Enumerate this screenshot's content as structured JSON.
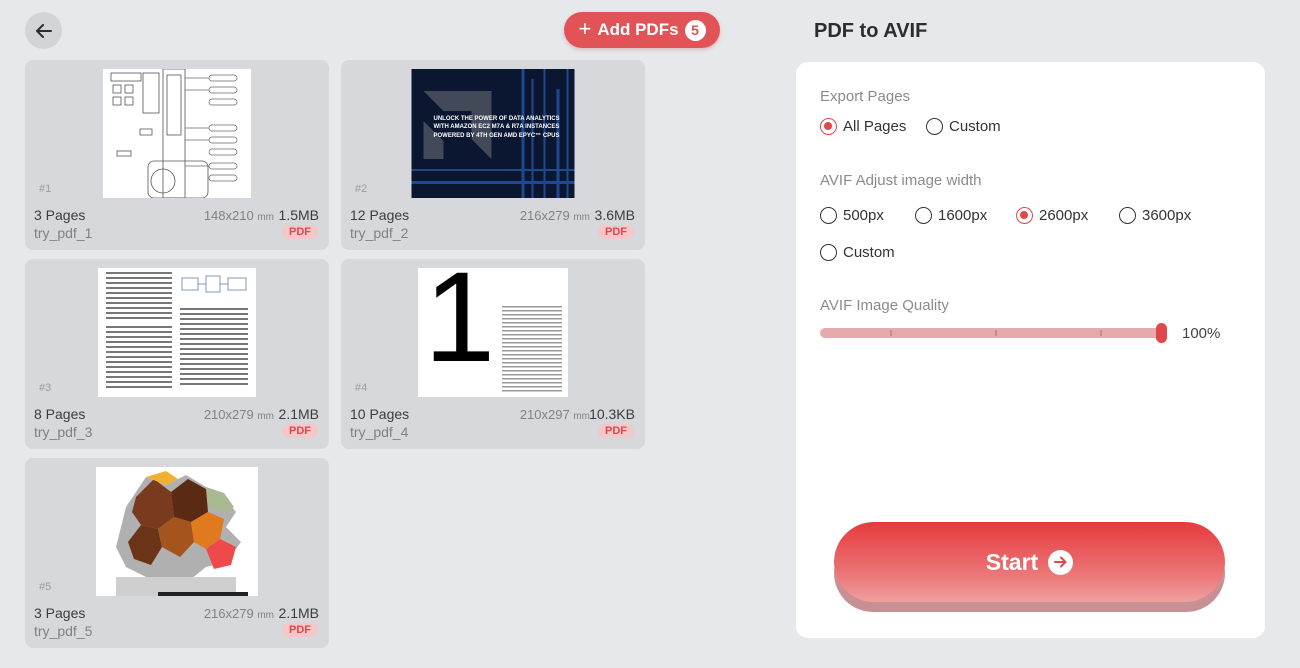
{
  "header": {
    "add_label": "Add PDFs",
    "add_count": "5"
  },
  "files": [
    {
      "index": "#1",
      "pages": "3 Pages",
      "name": "try_pdf_1",
      "dims": "148x210",
      "unit": "mm",
      "size": "1.5MB",
      "badge": "PDF"
    },
    {
      "index": "#2",
      "pages": "12 Pages",
      "name": "try_pdf_2",
      "dims": "216x279",
      "unit": "mm",
      "size": "3.6MB",
      "badge": "PDF",
      "thumb_text": "UNLOCK THE POWER OF DATA ANALYTICS WITH AMAZON EC2 M7A & R7A INSTANCES POWERED BY 4TH GEN AMD EPYC™ CPUS"
    },
    {
      "index": "#3",
      "pages": "8 Pages",
      "name": "try_pdf_3",
      "dims": "210x279",
      "unit": "mm",
      "size": "2.1MB",
      "badge": "PDF"
    },
    {
      "index": "#4",
      "pages": "10 Pages",
      "name": "try_pdf_4",
      "dims": "210x297",
      "unit": "mm",
      "size": "10.3KB",
      "badge": "PDF",
      "thumb_text": "1"
    },
    {
      "index": "#5",
      "pages": "3 Pages",
      "name": "try_pdf_5",
      "dims": "216x279",
      "unit": "mm",
      "size": "2.1MB",
      "badge": "PDF"
    }
  ],
  "panel": {
    "title": "PDF to AVIF",
    "export_label": "Export Pages",
    "export_options": [
      "All Pages",
      "Custom"
    ],
    "export_selected": "All Pages",
    "width_label": "AVIF Adjust image width",
    "width_options": [
      "500px",
      "1600px",
      "2600px",
      "3600px",
      "Custom"
    ],
    "width_selected": "2600px",
    "quality_label": "AVIF Image Quality",
    "quality_value": "100%",
    "quality_fraction": 1.0,
    "start_label": "Start"
  },
  "colors": {
    "accent": "#e25358",
    "badge_bg": "#f4c7c9",
    "card_bg": "#d7d8dc",
    "page_bg": "#e7e8eb"
  },
  "icons": {
    "back": "arrow-left-icon",
    "add": "plus-icon",
    "start": "arrow-right-circle-icon"
  }
}
